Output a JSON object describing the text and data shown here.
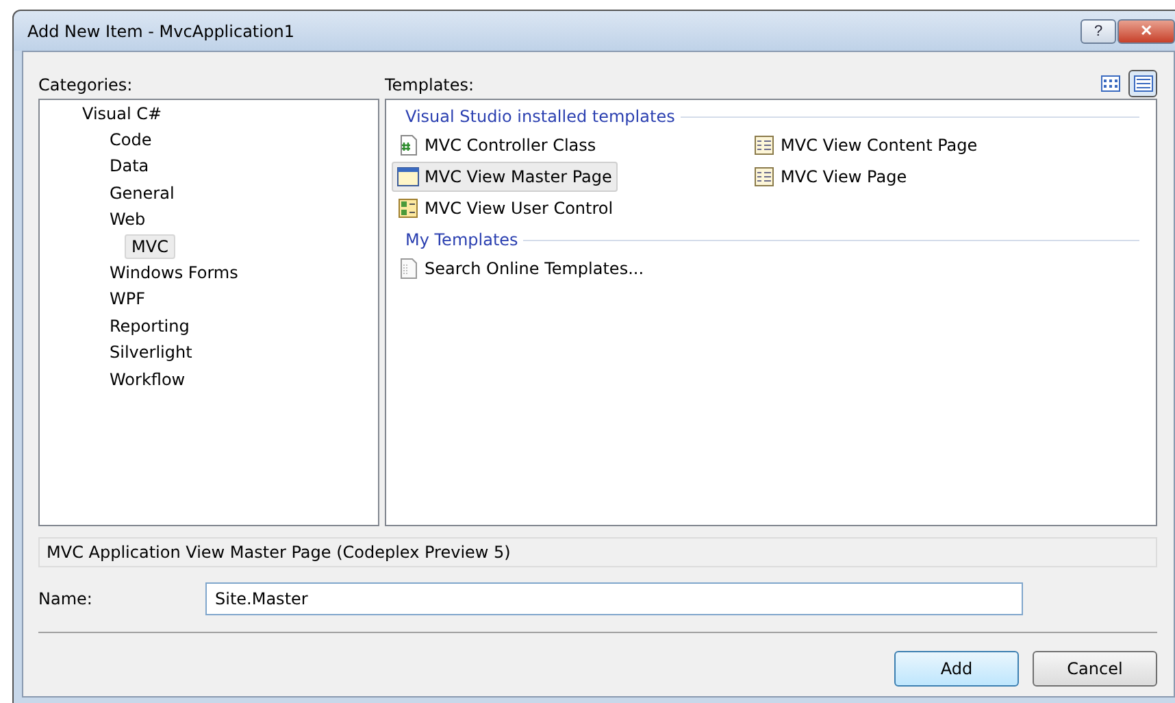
{
  "window": {
    "title": "Add New Item - MvcApplication1",
    "help": "?",
    "close": "✕"
  },
  "categories": {
    "label": "Categories:",
    "items": [
      {
        "label": "Visual C#",
        "selected": false,
        "children": [
          {
            "label": "Code",
            "selected": false
          },
          {
            "label": "Data",
            "selected": false
          },
          {
            "label": "General",
            "selected": false
          },
          {
            "label": "Web",
            "selected": false,
            "children": [
              {
                "label": "MVC",
                "selected": true
              }
            ]
          },
          {
            "label": "Windows Forms",
            "selected": false
          },
          {
            "label": "WPF",
            "selected": false
          },
          {
            "label": "Reporting",
            "selected": false
          },
          {
            "label": "Silverlight",
            "selected": false
          },
          {
            "label": "Workflow",
            "selected": false
          }
        ]
      }
    ]
  },
  "templates": {
    "label": "Templates:",
    "view_buttons": [
      {
        "kind": "icons",
        "selected": false
      },
      {
        "kind": "list",
        "selected": true
      }
    ],
    "groups": [
      {
        "title": "Visual Studio installed templates",
        "items": [
          {
            "label": "MVC Controller Class",
            "kind": "class",
            "selected": false
          },
          {
            "label": "MVC View Content Page",
            "kind": "page",
            "selected": false
          },
          {
            "label": "MVC View Master Page",
            "kind": "master",
            "selected": true
          },
          {
            "label": "MVC View Page",
            "kind": "page",
            "selected": false
          },
          {
            "label": "MVC View User Control",
            "kind": "control",
            "selected": false
          }
        ]
      },
      {
        "title": "My Templates",
        "items": [
          {
            "label": "Search Online Templates...",
            "kind": "search",
            "selected": false
          }
        ]
      }
    ]
  },
  "description": "MVC Application View Master Page (Codeplex Preview 5)",
  "name_field": {
    "label": "Name:",
    "value": "Site.Master"
  },
  "buttons": [
    {
      "label": "Add",
      "default": true
    },
    {
      "label": "Cancel",
      "default": false
    }
  ]
}
